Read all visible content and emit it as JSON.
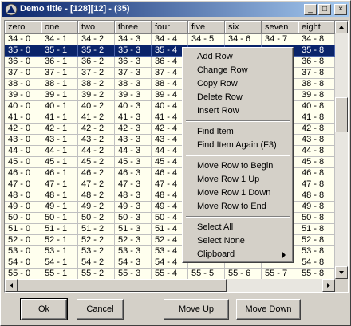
{
  "window": {
    "title": "Demo title - [128][12] - (35)",
    "minimize_glyph": "_",
    "maximize_glyph": "□",
    "close_glyph": "×"
  },
  "grid": {
    "columns": [
      "zero",
      "one",
      "two",
      "three",
      "four",
      "five",
      "six",
      "seven",
      "eight"
    ],
    "rows": [
      [
        "34 - 0",
        "34 - 1",
        "34 - 2",
        "34 - 3",
        "34 - 4",
        "34 - 5",
        "34 - 6",
        "34 - 7",
        "34 - 8"
      ],
      [
        "35 - 0",
        "35 - 1",
        "35 - 2",
        "35 - 3",
        "35 - 4",
        "",
        "",
        "",
        "35 - 8"
      ],
      [
        "36 - 0",
        "36 - 1",
        "36 - 2",
        "36 - 3",
        "36 - 4",
        "",
        "",
        "",
        "36 - 8"
      ],
      [
        "37 - 0",
        "37 - 1",
        "37 - 2",
        "37 - 3",
        "37 - 4",
        "",
        "",
        "",
        "37 - 8"
      ],
      [
        "38 - 0",
        "38 - 1",
        "38 - 2",
        "38 - 3",
        "38 - 4",
        "",
        "",
        "",
        "38 - 8"
      ],
      [
        "39 - 0",
        "39 - 1",
        "39 - 2",
        "39 - 3",
        "39 - 4",
        "",
        "",
        "",
        "39 - 8"
      ],
      [
        "40 - 0",
        "40 - 1",
        "40 - 2",
        "40 - 3",
        "40 - 4",
        "",
        "",
        "",
        "40 - 8"
      ],
      [
        "41 - 0",
        "41 - 1",
        "41 - 2",
        "41 - 3",
        "41 - 4",
        "",
        "",
        "",
        "41 - 8"
      ],
      [
        "42 - 0",
        "42 - 1",
        "42 - 2",
        "42 - 3",
        "42 - 4",
        "",
        "",
        "",
        "42 - 8"
      ],
      [
        "43 - 0",
        "43 - 1",
        "43 - 2",
        "43 - 3",
        "43 - 4",
        "",
        "",
        "",
        "43 - 8"
      ],
      [
        "44 - 0",
        "44 - 1",
        "44 - 2",
        "44 - 3",
        "44 - 4",
        "",
        "",
        "",
        "44 - 8"
      ],
      [
        "45 - 0",
        "45 - 1",
        "45 - 2",
        "45 - 3",
        "45 - 4",
        "",
        "",
        "",
        "45 - 8"
      ],
      [
        "46 - 0",
        "46 - 1",
        "46 - 2",
        "46 - 3",
        "46 - 4",
        "",
        "",
        "",
        "46 - 8"
      ],
      [
        "47 - 0",
        "47 - 1",
        "47 - 2",
        "47 - 3",
        "47 - 4",
        "",
        "",
        "",
        "47 - 8"
      ],
      [
        "48 - 0",
        "48 - 1",
        "48 - 2",
        "48 - 3",
        "48 - 4",
        "",
        "",
        "",
        "48 - 8"
      ],
      [
        "49 - 0",
        "49 - 1",
        "49 - 2",
        "49 - 3",
        "49 - 4",
        "",
        "",
        "",
        "49 - 8"
      ],
      [
        "50 - 0",
        "50 - 1",
        "50 - 2",
        "50 - 3",
        "50 - 4",
        "",
        "",
        "",
        "50 - 8"
      ],
      [
        "51 - 0",
        "51 - 1",
        "51 - 2",
        "51 - 3",
        "51 - 4",
        "",
        "",
        "",
        "51 - 8"
      ],
      [
        "52 - 0",
        "52 - 1",
        "52 - 2",
        "52 - 3",
        "52 - 4",
        "",
        "",
        "",
        "52 - 8"
      ],
      [
        "53 - 0",
        "53 - 1",
        "53 - 2",
        "53 - 3",
        "53 - 4",
        "",
        "",
        "",
        "53 - 8"
      ],
      [
        "54 - 0",
        "54 - 1",
        "54 - 2",
        "54 - 3",
        "54 - 4",
        "",
        "",
        "",
        "54 - 8"
      ],
      [
        "55 - 0",
        "55 - 1",
        "55 - 2",
        "55 - 3",
        "55 - 4",
        "55 - 5",
        "55 - 6",
        "55 - 7",
        "55 - 8"
      ]
    ],
    "selected_row_index": 1
  },
  "context_menu": {
    "items": [
      {
        "label": "Add Row"
      },
      {
        "label": "Change Row"
      },
      {
        "label": "Copy Row"
      },
      {
        "label": "Delete Row"
      },
      {
        "label": "Insert Row"
      },
      {
        "separator": true
      },
      {
        "label": "Find Item"
      },
      {
        "label": "Find Item Again (F3)"
      },
      {
        "separator": true
      },
      {
        "label": "Move Row to Begin"
      },
      {
        "label": "Move Row 1 Up"
      },
      {
        "label": "Move Row 1 Down"
      },
      {
        "label": "Move Row to End"
      },
      {
        "separator": true
      },
      {
        "label": "Select All"
      },
      {
        "label": "Select None"
      },
      {
        "label": "Clipboard",
        "submenu": true
      }
    ]
  },
  "buttons": {
    "ok": "Ok",
    "cancel": "Cancel",
    "move_up": "Move Up",
    "move_down": "Move Down"
  },
  "colors": {
    "title_start": "#0a246a",
    "title_end": "#a6caf0",
    "selection": "#0a246a",
    "cell_background": "#ffffee",
    "face": "#d4d0c8"
  }
}
